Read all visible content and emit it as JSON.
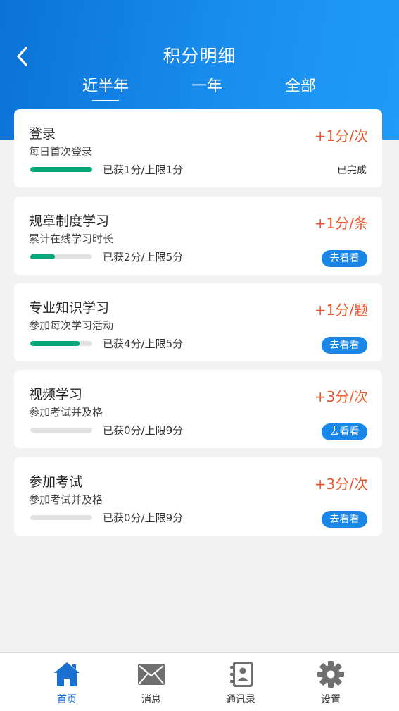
{
  "header": {
    "title": "积分明细",
    "back_icon": "chevron-left-icon",
    "tabs": [
      {
        "label": "近半年",
        "active": true
      },
      {
        "label": "一年",
        "active": false
      },
      {
        "label": "全部",
        "active": false
      }
    ]
  },
  "tasks": [
    {
      "title": "登录",
      "subtitle": "每日首次登录",
      "points": "+1分/次",
      "progress": 1.0,
      "progress_text": "已获1分/上限1分",
      "status": "已完成"
    },
    {
      "title": "规章制度学习",
      "subtitle": "累计在线学习时长",
      "points": "+1分/条",
      "progress": 0.4,
      "progress_text": "已获2分/上限5分",
      "action": "去看看"
    },
    {
      "title": "专业知识学习",
      "subtitle": "参加每次学习活动",
      "points": "+1分/题",
      "progress": 0.8,
      "progress_text": "已获4分/上限5分",
      "action": "去看看"
    },
    {
      "title": "视频学习",
      "subtitle": "参加考试并及格",
      "points": "+3分/次",
      "progress": 0.0,
      "progress_text": "已获0分/上限9分",
      "action": "去看看"
    },
    {
      "title": "参加考试",
      "subtitle": "参加考试并及格",
      "points": "+3分/次",
      "progress": 0.0,
      "progress_text": "已获0分/上限9分",
      "action": "去看看"
    }
  ],
  "tabbar": [
    {
      "label": "首页",
      "icon": "home-icon",
      "active": true
    },
    {
      "label": "消息",
      "icon": "mail-icon",
      "active": false
    },
    {
      "label": "通讯录",
      "icon": "contacts-icon",
      "active": false
    },
    {
      "label": "设置",
      "icon": "gear-icon",
      "active": false
    }
  ],
  "colors": {
    "header_start": "#0b72d6",
    "header_end": "#1e9cf7",
    "points": "#e9572c",
    "progress_fill": "#0aa57a",
    "button": "#1a86e8",
    "tab_active": "#1a6fd0"
  }
}
